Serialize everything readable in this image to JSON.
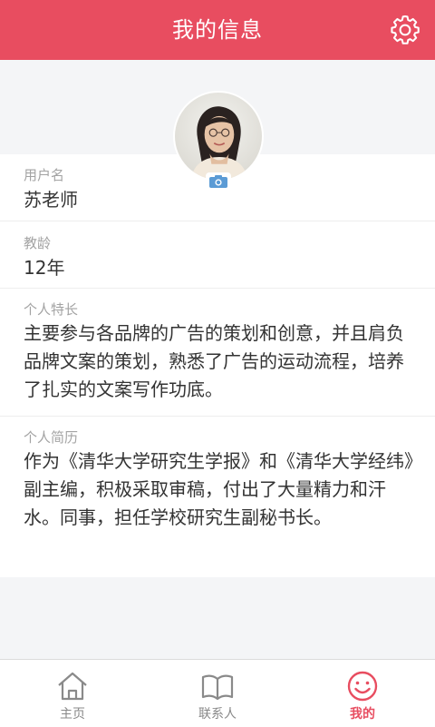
{
  "header": {
    "title": "我的信息",
    "settings_icon": "gear-icon"
  },
  "profile": {
    "avatar_icon": "avatar",
    "camera_icon": "camera-icon",
    "fields": [
      {
        "label": "用户名",
        "value": "苏老师"
      },
      {
        "label": "教龄",
        "value": "12年"
      },
      {
        "label": "个人特长",
        "value": "主要参与各品牌的广告的策划和创意，并且肩负品牌文案的策划，熟悉了广告的运动流程，培养了扎实的文案写作功底。"
      },
      {
        "label": "个人简历",
        "value": "作为《清华大学研究生学报》和《清华大学经纬》副主编，积极采取审稿，付出了大量精力和汗水。同事，担任学校研究生副秘书长。"
      }
    ]
  },
  "tabbar": {
    "items": [
      {
        "label": "主页",
        "icon": "home-icon",
        "active": false
      },
      {
        "label": "联系人",
        "icon": "book-icon",
        "active": false
      },
      {
        "label": "我的",
        "icon": "smiley-icon",
        "active": true
      }
    ]
  },
  "colors": {
    "accent": "#e84d60",
    "background": "#f4f5f7"
  }
}
